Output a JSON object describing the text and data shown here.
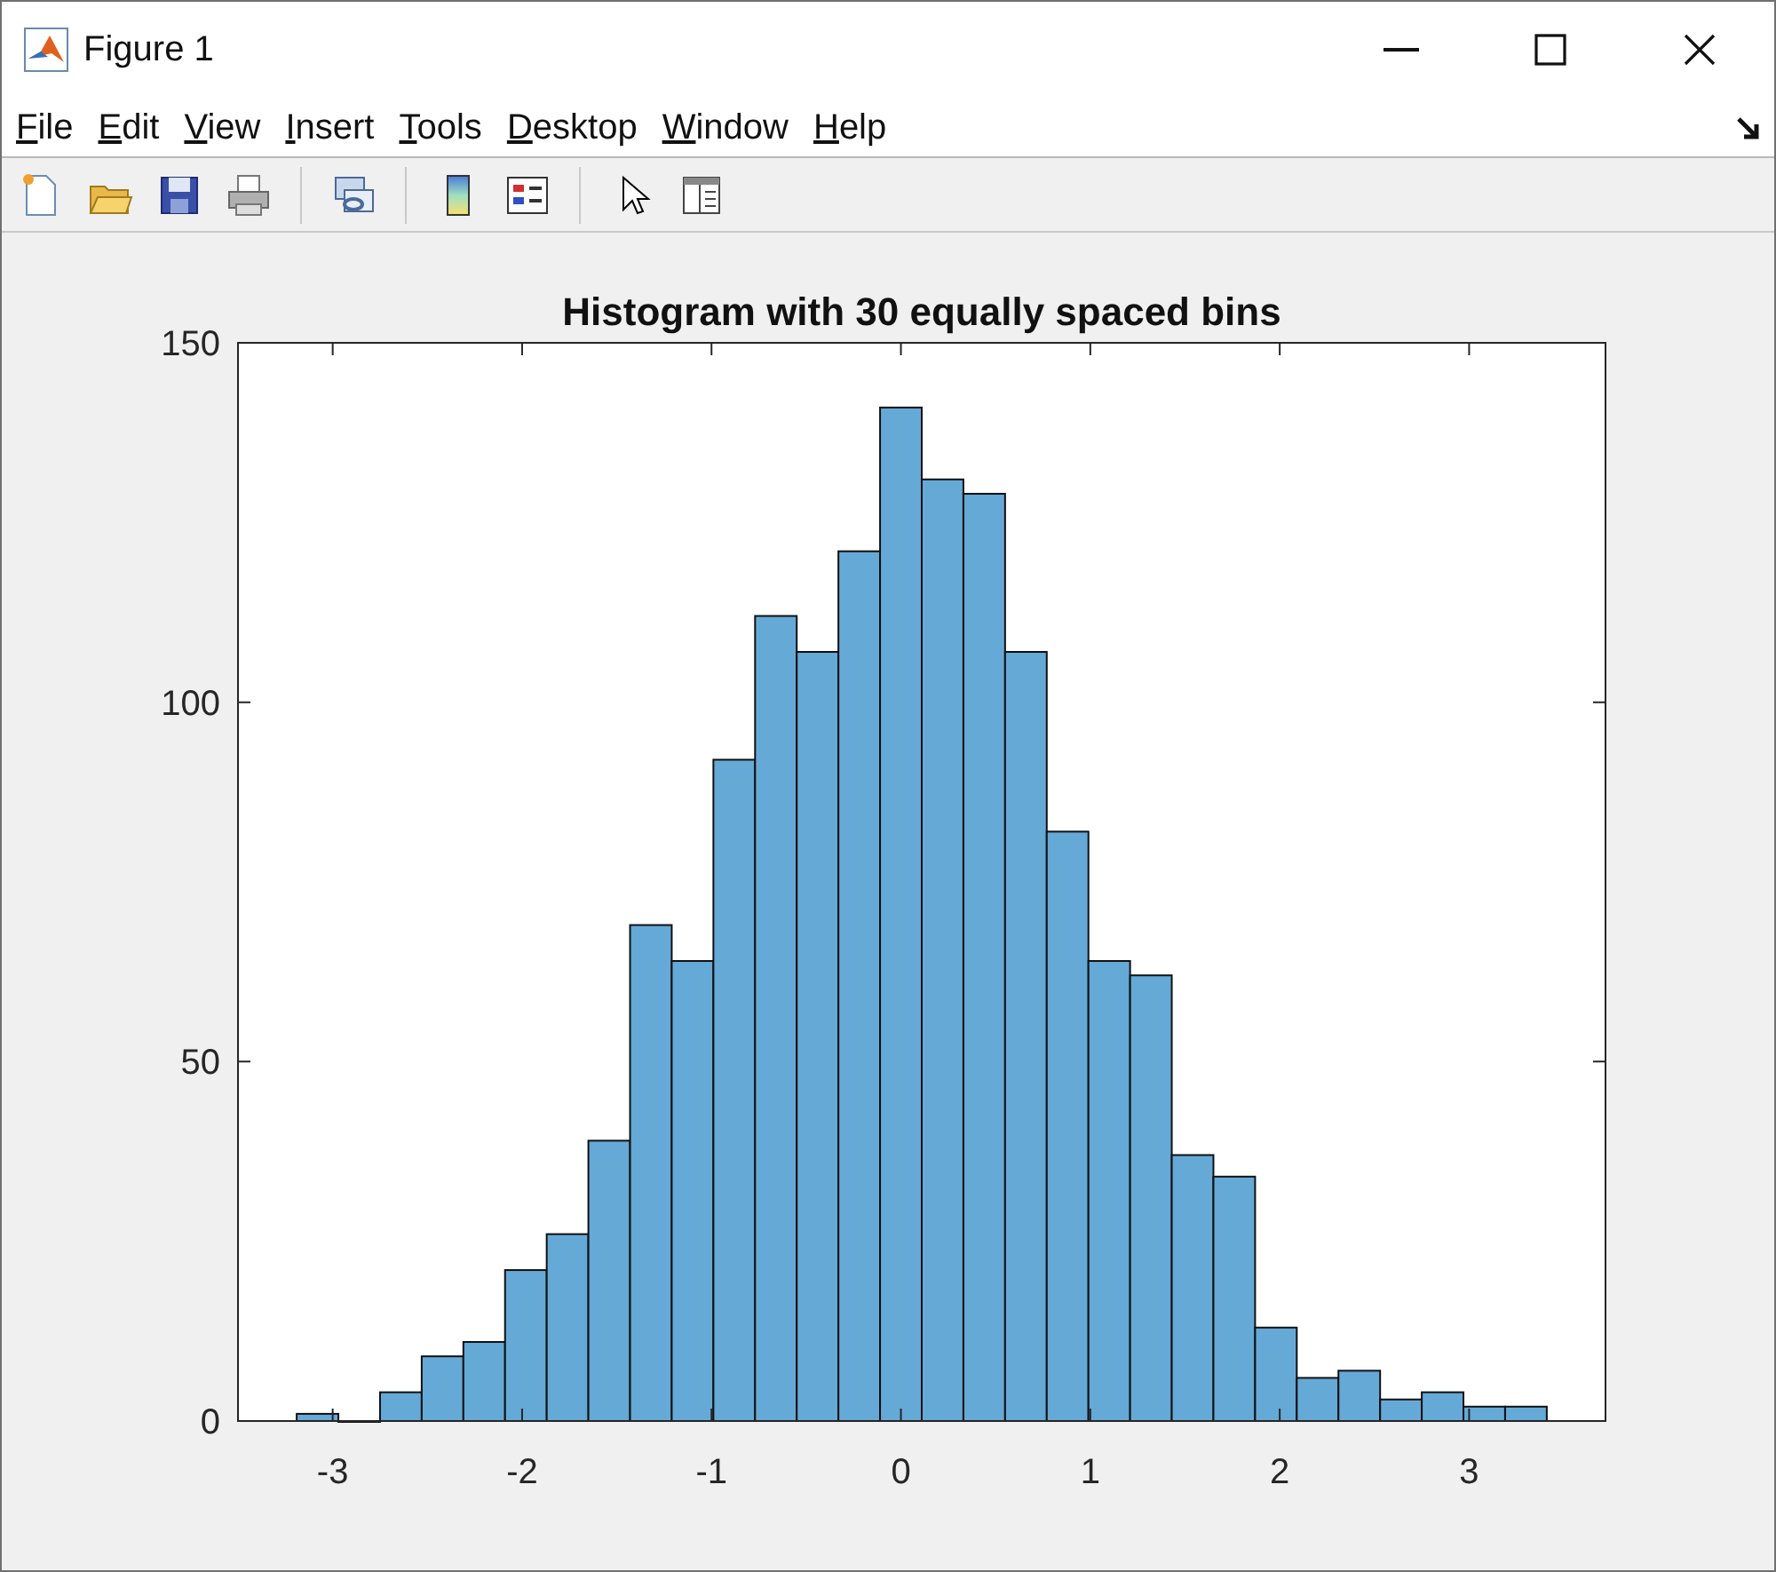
{
  "window": {
    "title": "Figure 1"
  },
  "menu": [
    {
      "label": "File"
    },
    {
      "label": "Edit"
    },
    {
      "label": "View"
    },
    {
      "label": "Insert"
    },
    {
      "label": "Tools"
    },
    {
      "label": "Desktop"
    },
    {
      "label": "Window"
    },
    {
      "label": "Help"
    }
  ],
  "toolbar": [
    {
      "kind": "new"
    },
    {
      "kind": "open"
    },
    {
      "kind": "save"
    },
    {
      "kind": "print"
    },
    {
      "kind": "separator"
    },
    {
      "kind": "link"
    },
    {
      "kind": "separator"
    },
    {
      "kind": "colorbar"
    },
    {
      "kind": "legend"
    },
    {
      "kind": "separator"
    },
    {
      "kind": "pointer"
    },
    {
      "kind": "inspector"
    }
  ],
  "figure": {
    "chart_data": {
      "type": "bar",
      "title": "Histogram with 30 equally spaced bins",
      "x": [
        -3.08,
        -2.86,
        -2.64,
        -2.42,
        -2.2,
        -1.98,
        -1.76,
        -1.54,
        -1.32,
        -1.1,
        -0.88,
        -0.66,
        -0.44,
        -0.22,
        0,
        0.22,
        0.44,
        0.66,
        0.88,
        1.1,
        1.32,
        1.54,
        1.76,
        1.98,
        2.2,
        2.42,
        2.64,
        2.86,
        3.08,
        3.3
      ],
      "series": [
        {
          "color": "#65a9d7",
          "values": [
            1,
            0,
            4,
            9,
            11,
            21,
            26,
            39,
            69,
            64,
            92,
            112,
            107,
            121,
            141,
            131,
            129,
            107,
            82,
            64,
            62,
            37,
            34,
            13,
            6,
            7,
            3,
            4,
            2,
            2
          ]
        }
      ],
      "xlim": [
        -3.5,
        3.72
      ],
      "ylim": [
        0,
        150
      ],
      "xticks": [
        -3,
        -2,
        -1,
        0,
        1,
        2,
        3
      ],
      "yticks": [
        0,
        50,
        100,
        150
      ]
    }
  }
}
